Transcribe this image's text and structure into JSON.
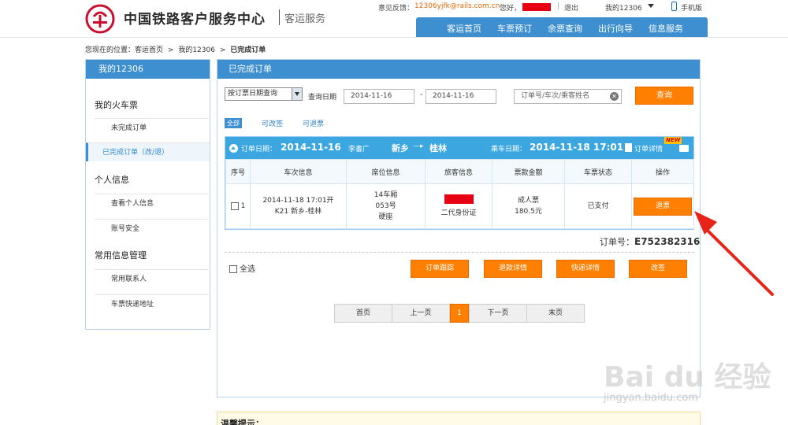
{
  "header": {
    "site_title": "中国铁路客户服务中心",
    "site_subtitle": "客运服务",
    "feedback_label": "意见反馈：",
    "feedback_email": "12306yjfk@rails.com.cn",
    "hello": "您好，",
    "logout": "退出",
    "my12306": "我的12306",
    "mobile": "手机版",
    "nav": [
      "客运首页",
      "车票预订",
      "余票查询",
      "出行向导",
      "信息服务"
    ]
  },
  "breadcrumb": {
    "prefix": "您现在的位置：客运首页",
    "sep1": ">",
    "level2": "我的12306",
    "sep2": ">",
    "current": "已完成订单"
  },
  "sidebar": {
    "title": "我的12306",
    "group_tickets": "我的火车票",
    "item_unfinished": "未完成订单",
    "item_finished": "已完成订单（改/退）",
    "group_personal": "个人信息",
    "item_view_info": "查看个人信息",
    "item_security": "账号安全",
    "group_common": "常用信息管理",
    "item_contacts": "常用联系人",
    "item_address": "车票快递地址"
  },
  "main": {
    "title": "已完成订单",
    "query": {
      "type_selected": "按订票日期查询",
      "date_label": "查询日期",
      "date_from": "2014-11-16",
      "dash": "-",
      "date_to": "2014-11-16",
      "search_placeholder": "订单号/车次/乘客姓名",
      "search_button": "查询"
    },
    "filters": [
      "全部",
      "可改签",
      "可退票"
    ],
    "order": {
      "order_date_label": "订单日期：",
      "order_date": "2014-11-16",
      "booker": "李書广",
      "from": "新乡",
      "to_sep": "—▸",
      "to": "桂林",
      "depart_label": "乘车日期：",
      "depart_time": "2014-11-18 17:01",
      "detail_label": "订单详情",
      "new_badge": "NEW",
      "columns": [
        "序号",
        "车次信息",
        "席位信息",
        "旅客信息",
        "票款金额",
        "车票状态",
        "操作"
      ],
      "rows": [
        {
          "index": "1",
          "train_time": "2014-11-18 17:01开",
          "train_route": "K21 新乡-桂林",
          "seat_car": "14车厢",
          "seat_no": "053号",
          "seat_type": "硬座",
          "id_type": "二代身份证",
          "ticket_type": "成人票",
          "price": "180.5元",
          "status": "已支付",
          "action": "退票"
        }
      ],
      "order_no_label": "订单号：",
      "order_no": "E752382316",
      "select_all": "全选",
      "actions": [
        "订单跟踪",
        "退款详情",
        "快递详情",
        "改签"
      ]
    },
    "pagination": [
      "首页",
      "上一页",
      "1",
      "下一页",
      "末页"
    ]
  },
  "tips": {
    "title": "温馨提示："
  },
  "watermark": {
    "brand": "Bai du 经验",
    "url": "jingyan.baidu.com"
  },
  "colors": {
    "primary_blue": "#3d8fd0",
    "order_bar_blue": "#3ba6e0",
    "accent_orange": "#ff7f00",
    "alert_red": "#e60012"
  }
}
